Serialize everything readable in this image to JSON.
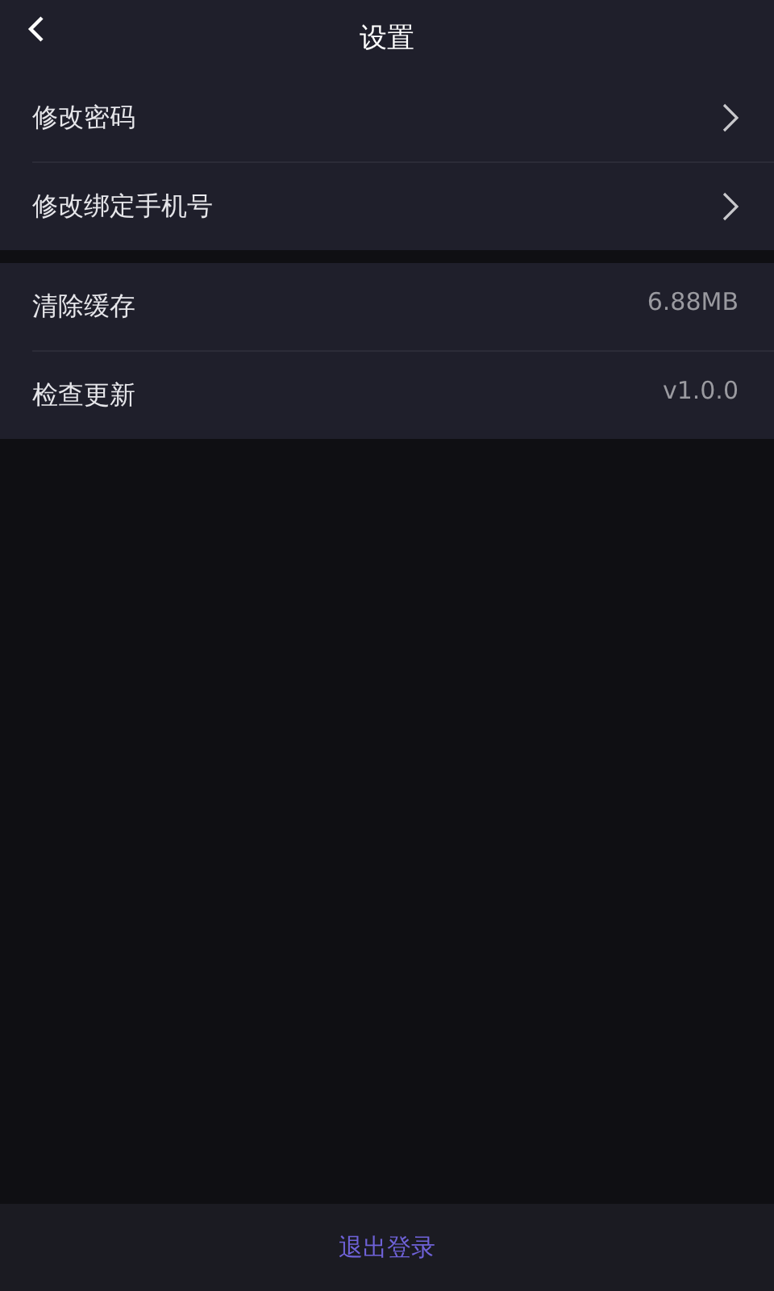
{
  "header": {
    "title": "设置"
  },
  "groups": [
    {
      "items": [
        {
          "kind": "link",
          "label": "修改密码"
        },
        {
          "kind": "link",
          "label": "修改绑定手机号"
        }
      ]
    },
    {
      "items": [
        {
          "kind": "value",
          "label": "清除缓存",
          "value": "6.88MB"
        },
        {
          "kind": "value",
          "label": "检查更新",
          "value": "v1.0.0"
        }
      ]
    }
  ],
  "logout": {
    "label": "退出登录"
  }
}
